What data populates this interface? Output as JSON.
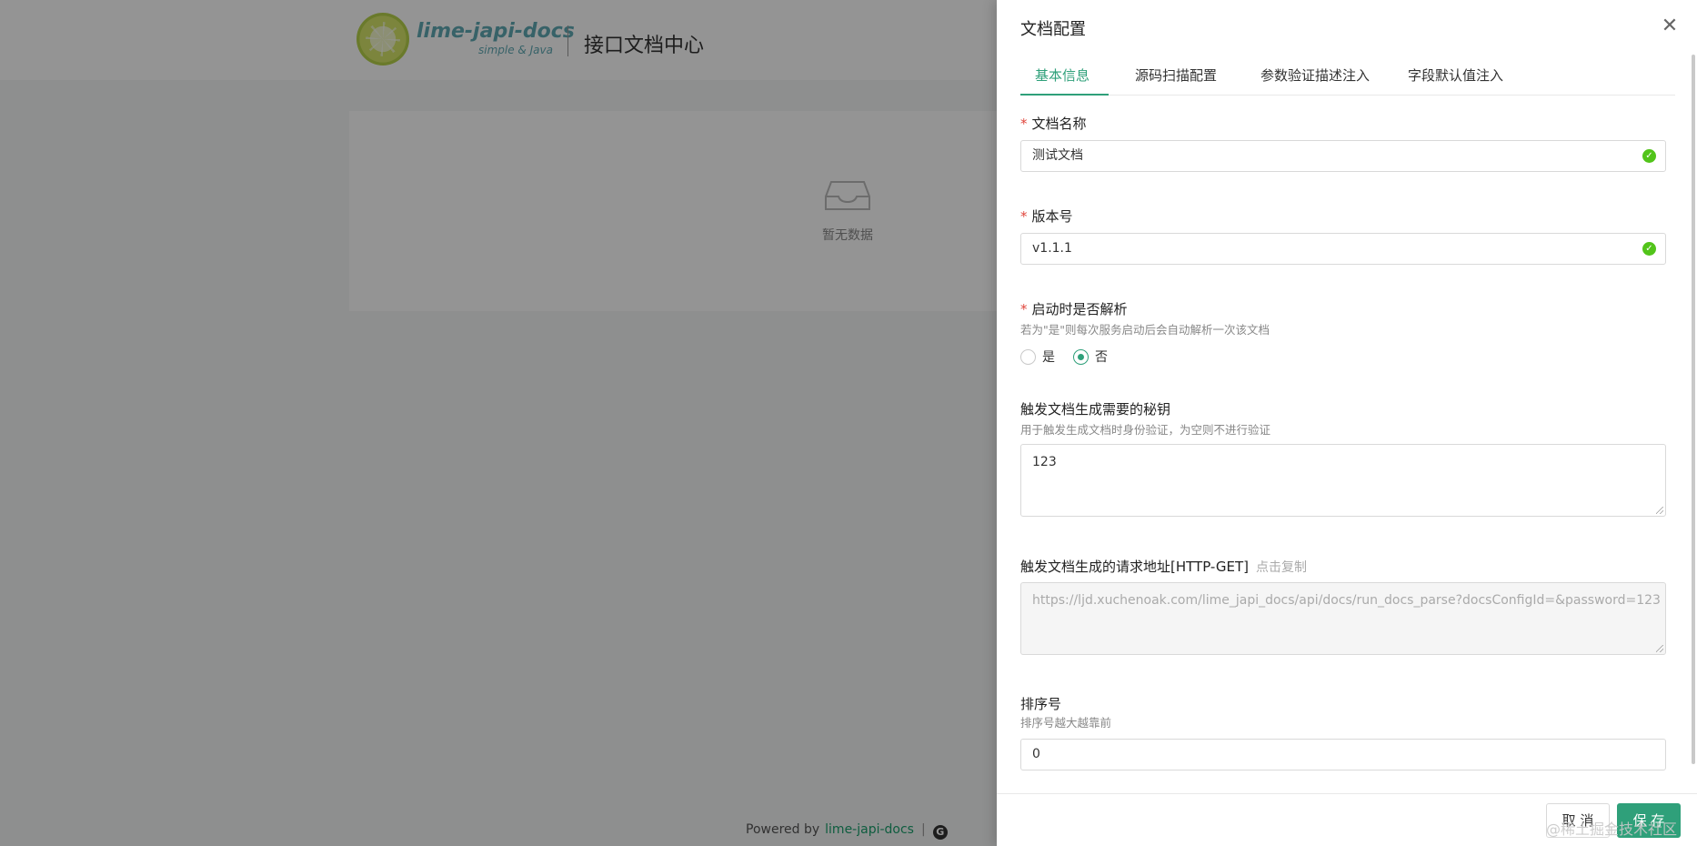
{
  "header": {
    "brand_name": "lime-japi-docs",
    "brand_sub": "simple & Java",
    "title": "接口文档中心"
  },
  "content": {
    "empty_text": "暂无数据"
  },
  "footer": {
    "powered_by": "Powered by",
    "link": "lime-japi-docs",
    "separator": "|",
    "icon_glyph": "G"
  },
  "drawer": {
    "title": "文档配置",
    "close_glyph": "✕",
    "tabs": [
      {
        "label": "基本信息",
        "active": true
      },
      {
        "label": "源码扫描配置",
        "active": false
      },
      {
        "label": "参数验证描述注入",
        "active": false
      },
      {
        "label": "字段默认值注入",
        "active": false
      }
    ],
    "form": {
      "doc_name": {
        "label": "文档名称",
        "required": "*",
        "value": "测试文档",
        "status_icon": "success-check-icon"
      },
      "version": {
        "label": "版本号",
        "required": "*",
        "value": "v1.1.1",
        "status_icon": "success-check-icon"
      },
      "parse_on_start": {
        "label": "启动时是否解析",
        "required": "*",
        "help": "若为\"是\"则每次服务启动后会自动解析一次该文档",
        "options": [
          "是",
          "否"
        ],
        "selected": "否"
      },
      "secret": {
        "label": "触发文档生成需要的秘钥",
        "help": "用于触发生成文档时身份验证，为空则不进行验证",
        "value": "123"
      },
      "request_url": {
        "label": "触发文档生成的请求地址[HTTP-GET]",
        "copy_link": "点击复制",
        "value": "https://ljd.xuchenoak.com/lime_japi_docs/api/docs/run_docs_parse?docsConfigId=&password=123"
      },
      "sort": {
        "label": "排序号",
        "help": "排序号越大越靠前",
        "value": "0"
      }
    },
    "buttons": {
      "cancel": "取 消",
      "save": "保 存"
    }
  },
  "watermark": "@稀土掘金技术社区",
  "colors": {
    "accent": "#2fa07a",
    "required": "#e0463c",
    "success": "#52c41a"
  }
}
